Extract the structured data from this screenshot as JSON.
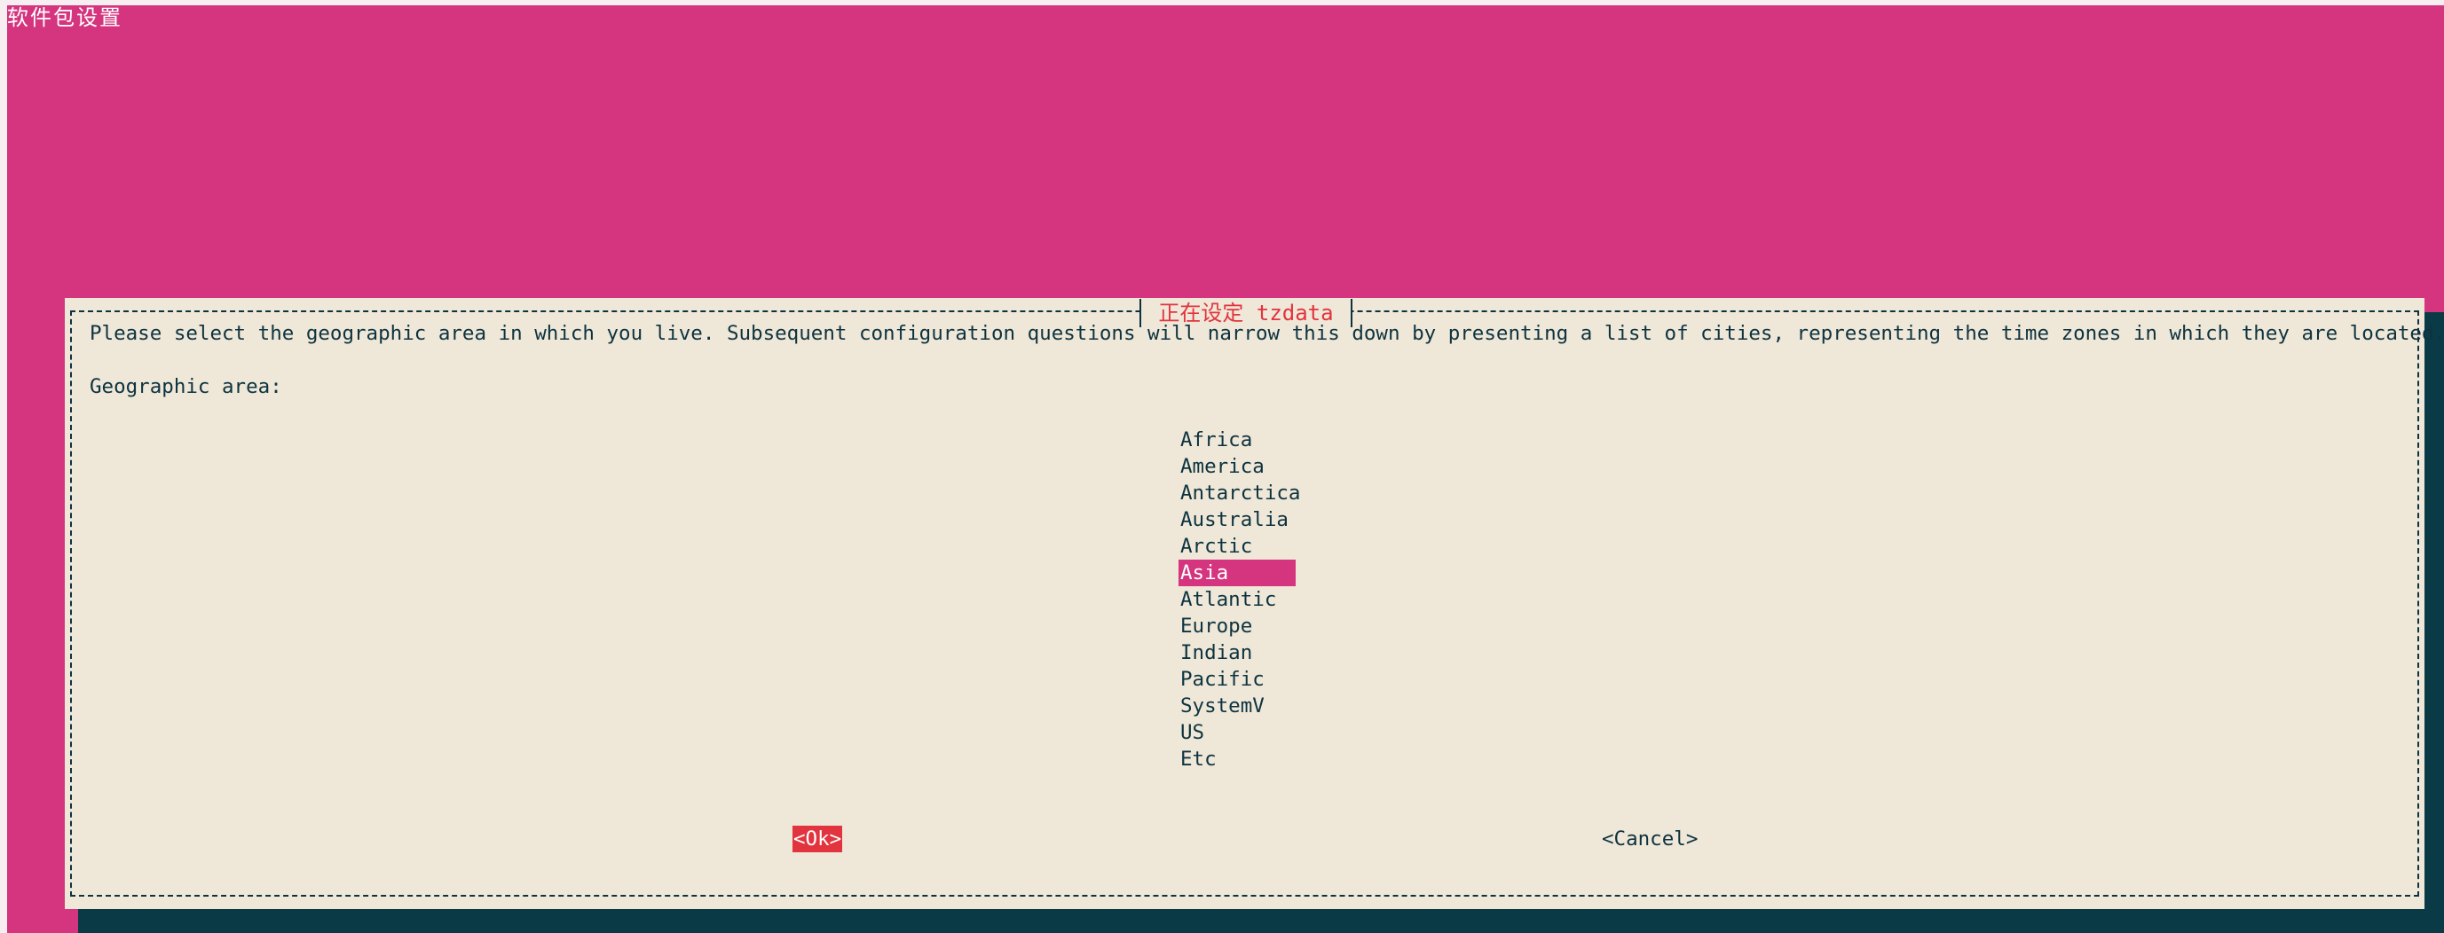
{
  "screen": {
    "backtitle": "软件包设置"
  },
  "dialog": {
    "title": "正在设定 tzdata",
    "question": "Please select the geographic area in which you live. Subsequent configuration questions will narrow this down by presenting a list of cities, representing the time zones in which they are located.",
    "list_label": "Geographic area:",
    "areas": [
      {
        "label": "Africa",
        "selected": false
      },
      {
        "label": "America",
        "selected": false
      },
      {
        "label": "Antarctica",
        "selected": false
      },
      {
        "label": "Australia",
        "selected": false
      },
      {
        "label": "Arctic",
        "selected": false
      },
      {
        "label": "Asia",
        "selected": true
      },
      {
        "label": "Atlantic",
        "selected": false
      },
      {
        "label": "Europe",
        "selected": false
      },
      {
        "label": "Indian",
        "selected": false
      },
      {
        "label": "Pacific",
        "selected": false
      },
      {
        "label": "SystemV",
        "selected": false
      },
      {
        "label": "US",
        "selected": false
      },
      {
        "label": "Etc",
        "selected": false
      }
    ],
    "buttons": {
      "ok": "<Ok>",
      "cancel": "<Cancel>"
    }
  },
  "colors": {
    "background": "#d4357e",
    "dialog": "#efe7d7",
    "text": "#0d3340",
    "highlight": "#d4357e",
    "title": "#e2343f",
    "ok_button": "#e2343f",
    "shadow": "#0b3a47"
  }
}
